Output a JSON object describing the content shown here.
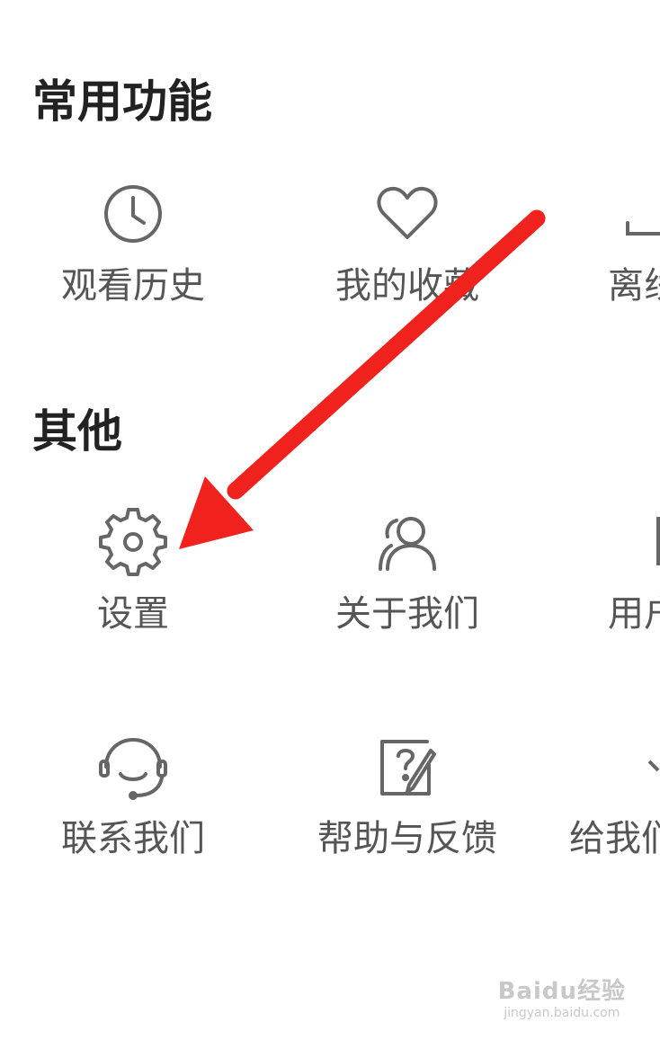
{
  "common": {
    "title": "常用功能",
    "items": [
      {
        "label": "观看历史",
        "icon": "clock-icon"
      },
      {
        "label": "我的收藏",
        "icon": "heart-icon"
      },
      {
        "label": "离线",
        "icon": "download-icon"
      }
    ]
  },
  "other": {
    "title": "其他",
    "row1": [
      {
        "label": "设置",
        "icon": "gear-icon"
      },
      {
        "label": "关于我们",
        "icon": "users-icon"
      },
      {
        "label": "用户",
        "icon": "document-icon"
      }
    ],
    "row2": [
      {
        "label": "联系我们",
        "icon": "headset-icon"
      },
      {
        "label": "帮助与反馈",
        "icon": "help-edit-icon"
      },
      {
        "label": "给我们",
        "icon": "star-icon"
      }
    ]
  },
  "annotation": {
    "arrow_color": "#f0221e"
  },
  "watermark": {
    "logo": "Baidu经验",
    "url": "jingyan.baidu.com"
  },
  "colors": {
    "icon": "#666666",
    "label": "#555555",
    "title": "#222222"
  }
}
